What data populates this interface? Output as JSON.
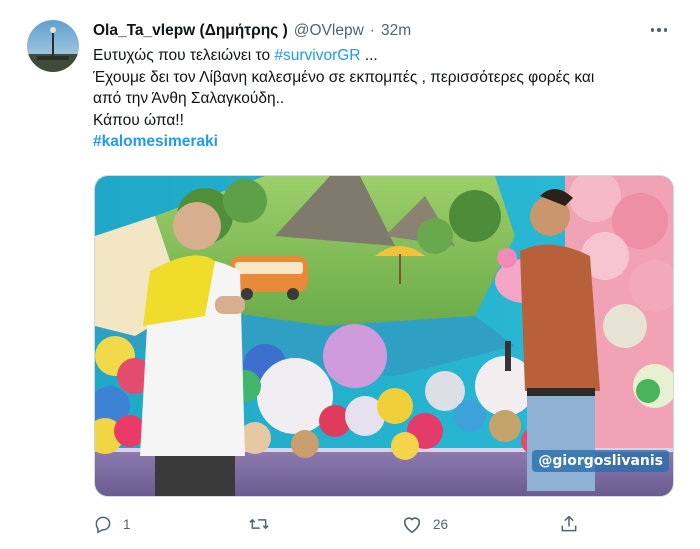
{
  "tweet": {
    "display_name": "Ola_Ta_vlepw (Δημήτρης )",
    "handle": "@OVlepw",
    "separator": "·",
    "time": "32m",
    "line1_text": "Ευτυχώς που τελειώνει το ",
    "line1_link": "#survivorGR",
    "line1_end": " ...",
    "line2": "Έχουμε δει τον Λίβανη καλεσμένο σε εκπομπές , περισσότερες φορές και",
    "line3": "από την Άνθη Σαλαγκούδη..",
    "line4": "Κάπου ώπα!!",
    "hashtag": "#kalomesimeraki",
    "media_watermark": "@giorgoslivanis",
    "actions": {
      "reply_count": "1",
      "retweet_count": "",
      "like_count": "26"
    }
  },
  "icons": {
    "more": "more-horizontal-icon",
    "reply": "reply-icon",
    "retweet": "retweet-icon",
    "like": "heart-icon",
    "share": "share-icon"
  },
  "colors": {
    "link": "#1d9bf0",
    "secondary_text": "#536471",
    "primary_text": "#0f1419"
  }
}
